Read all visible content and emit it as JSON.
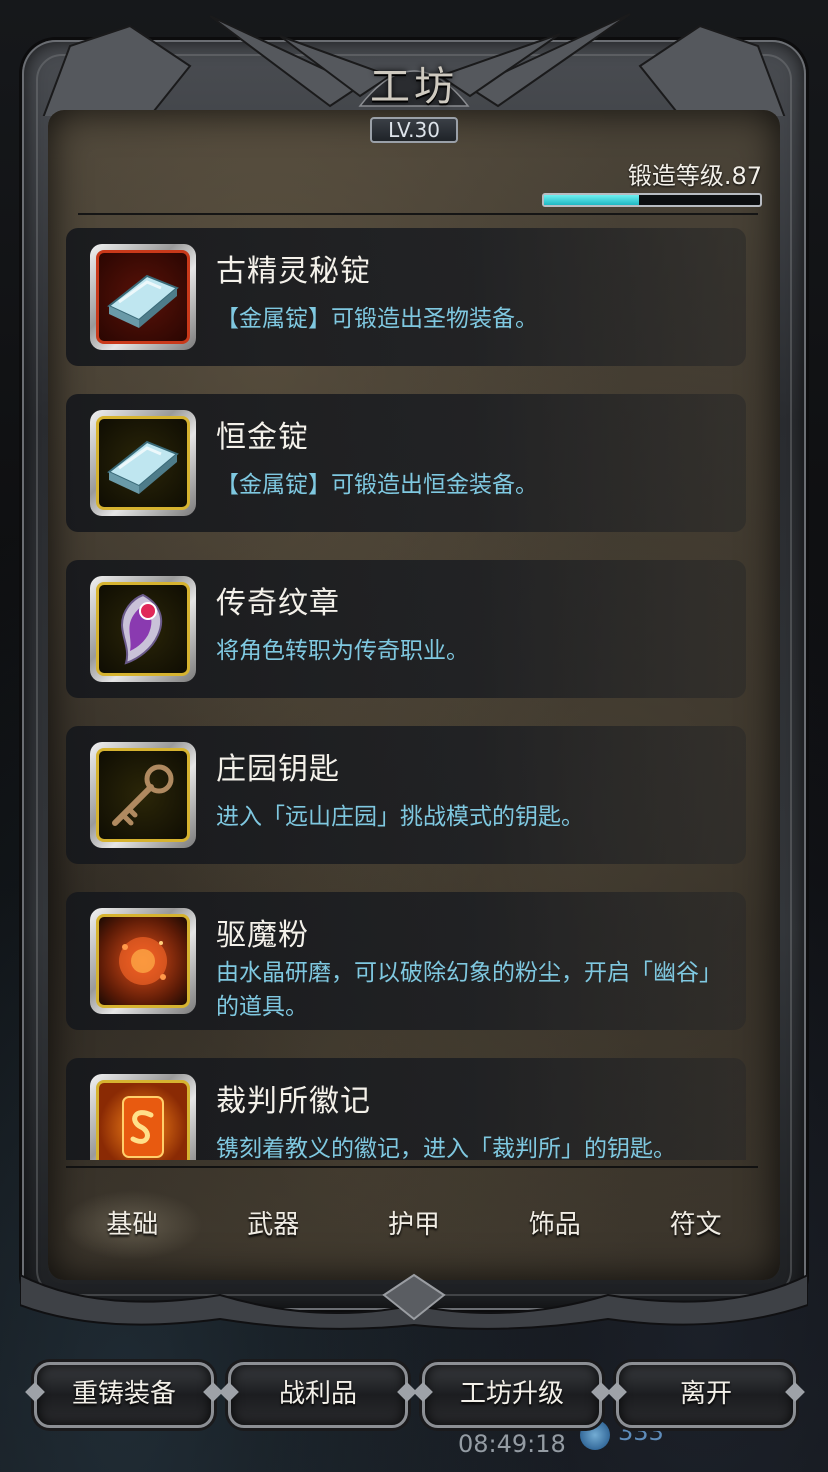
{
  "header": {
    "title": "工坊",
    "level_badge": "LV.30",
    "forge_level_label": "锻造等级.87",
    "forge_progress": 0.44
  },
  "items": [
    {
      "name": "古精灵秘锭",
      "desc": "【金属锭】可锻造出圣物装备。",
      "icon": "blue-ingot-icon",
      "frame": "red"
    },
    {
      "name": "恒金锭",
      "desc": "【金属锭】可锻造出恒金装备。",
      "icon": "blue-ingot-icon",
      "frame": "gold"
    },
    {
      "name": "传奇纹章",
      "desc": "将角色转职为传奇职业。",
      "icon": "crest-emblem-icon",
      "frame": "gold"
    },
    {
      "name": "庄园钥匙",
      "desc": "进入「远山庄园」挑战模式的钥匙。",
      "icon": "key-icon",
      "frame": "gold"
    },
    {
      "name": "驱魔粉",
      "desc": "由水晶研磨，可以破除幻象的粉尘，开启「幽谷」的道具。",
      "icon": "red-powder-icon",
      "frame": "gold"
    },
    {
      "name": "裁判所徽记",
      "desc": "镌刻着教义的徽记，进入「裁判所」的钥匙。",
      "icon": "fire-sigil-icon",
      "frame": "gold"
    }
  ],
  "tabs": [
    {
      "label": "基础",
      "active": true
    },
    {
      "label": "武器",
      "active": false
    },
    {
      "label": "护甲",
      "active": false
    },
    {
      "label": "饰品",
      "active": false
    },
    {
      "label": "符文",
      "active": false
    }
  ],
  "buttons": {
    "reforge": "重铸装备",
    "loot": "战利品",
    "upgrade": "工坊升级",
    "leave": "离开"
  },
  "hud": {
    "time": "08:49:18",
    "gems": "333"
  },
  "colors": {
    "desc_text": "#7fc8e0",
    "progress_fill": "#2fd0d8",
    "frame_gold": "#d6b330",
    "frame_red": "#c9391a"
  }
}
